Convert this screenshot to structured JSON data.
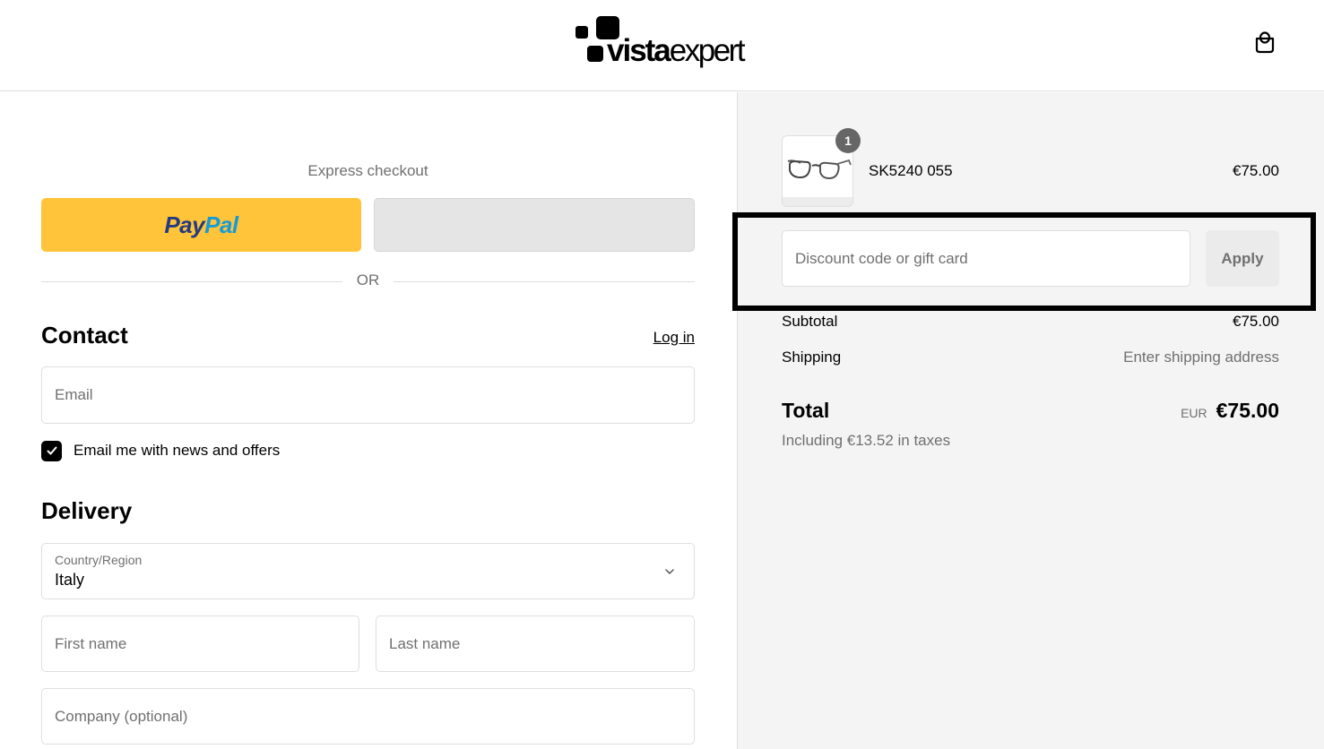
{
  "header": {
    "logo": {
      "bold": "vista",
      "light": "expert"
    },
    "cart_icon": "shopping-bag-icon"
  },
  "express_checkout": {
    "label": "Express checkout",
    "paypal": {
      "part1": "Pay",
      "part2": "Pal",
      "brand_color": "#ffc439"
    },
    "alt_payment_color": "#e5e5e5",
    "divider_label": "OR"
  },
  "contact": {
    "title": "Contact",
    "login_link": "Log in",
    "email": {
      "placeholder": "Email",
      "value": ""
    },
    "newsletter": {
      "label": "Email me with news and offers",
      "checked": true
    }
  },
  "delivery": {
    "title": "Delivery",
    "country": {
      "label": "Country/Region",
      "value": "Italy"
    },
    "first_name": {
      "placeholder": "First name"
    },
    "last_name": {
      "placeholder": "Last name"
    },
    "company": {
      "placeholder": "Company (optional)"
    }
  },
  "order_summary": {
    "items": [
      {
        "name": "SK5240 055",
        "price": "€75.00",
        "quantity": "1",
        "image": "eyeglasses"
      }
    ],
    "discount": {
      "placeholder": "Discount code or gift card",
      "apply_label": "Apply"
    },
    "subtotal": {
      "label": "Subtotal",
      "value": "€75.00"
    },
    "shipping": {
      "label": "Shipping",
      "value": "Enter shipping address"
    },
    "total": {
      "label": "Total",
      "currency": "EUR",
      "value": "€75.00"
    },
    "tax_note": "Including €13.52 in taxes"
  },
  "colors": {
    "accent": "#000000",
    "muted_text": "#707070",
    "summary_bg": "#f4f4f4",
    "border": "#dedede"
  }
}
